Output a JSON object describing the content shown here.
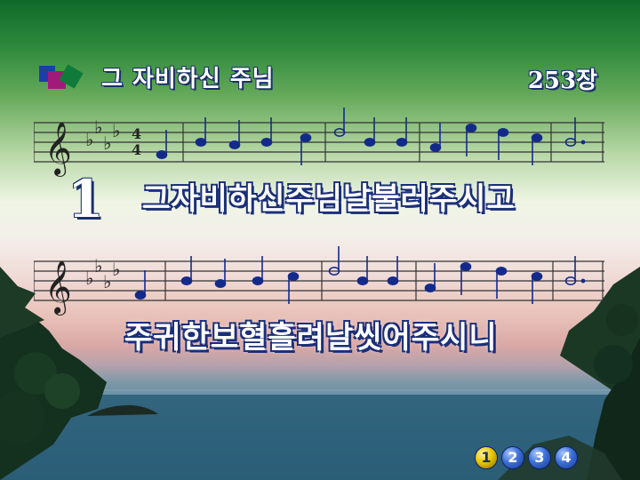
{
  "hymn": {
    "title": "그 자비하신 주님",
    "number": "253장",
    "verse_label": "1",
    "lyrics": [
      "그자비하신주님날불러주시고",
      "주귀한보혈흘려날씻어주시니"
    ]
  },
  "verse_nav": {
    "buttons": [
      "1",
      "2",
      "3",
      "4"
    ],
    "active": "1"
  },
  "music": {
    "clef": "treble",
    "key_signature": "A-flat major (4 flats)",
    "time_signature": "4/4"
  },
  "colors": {
    "title_blue": "#1a2f6a",
    "note_blue": "#142a8a",
    "active_verse": "#e9c400"
  }
}
